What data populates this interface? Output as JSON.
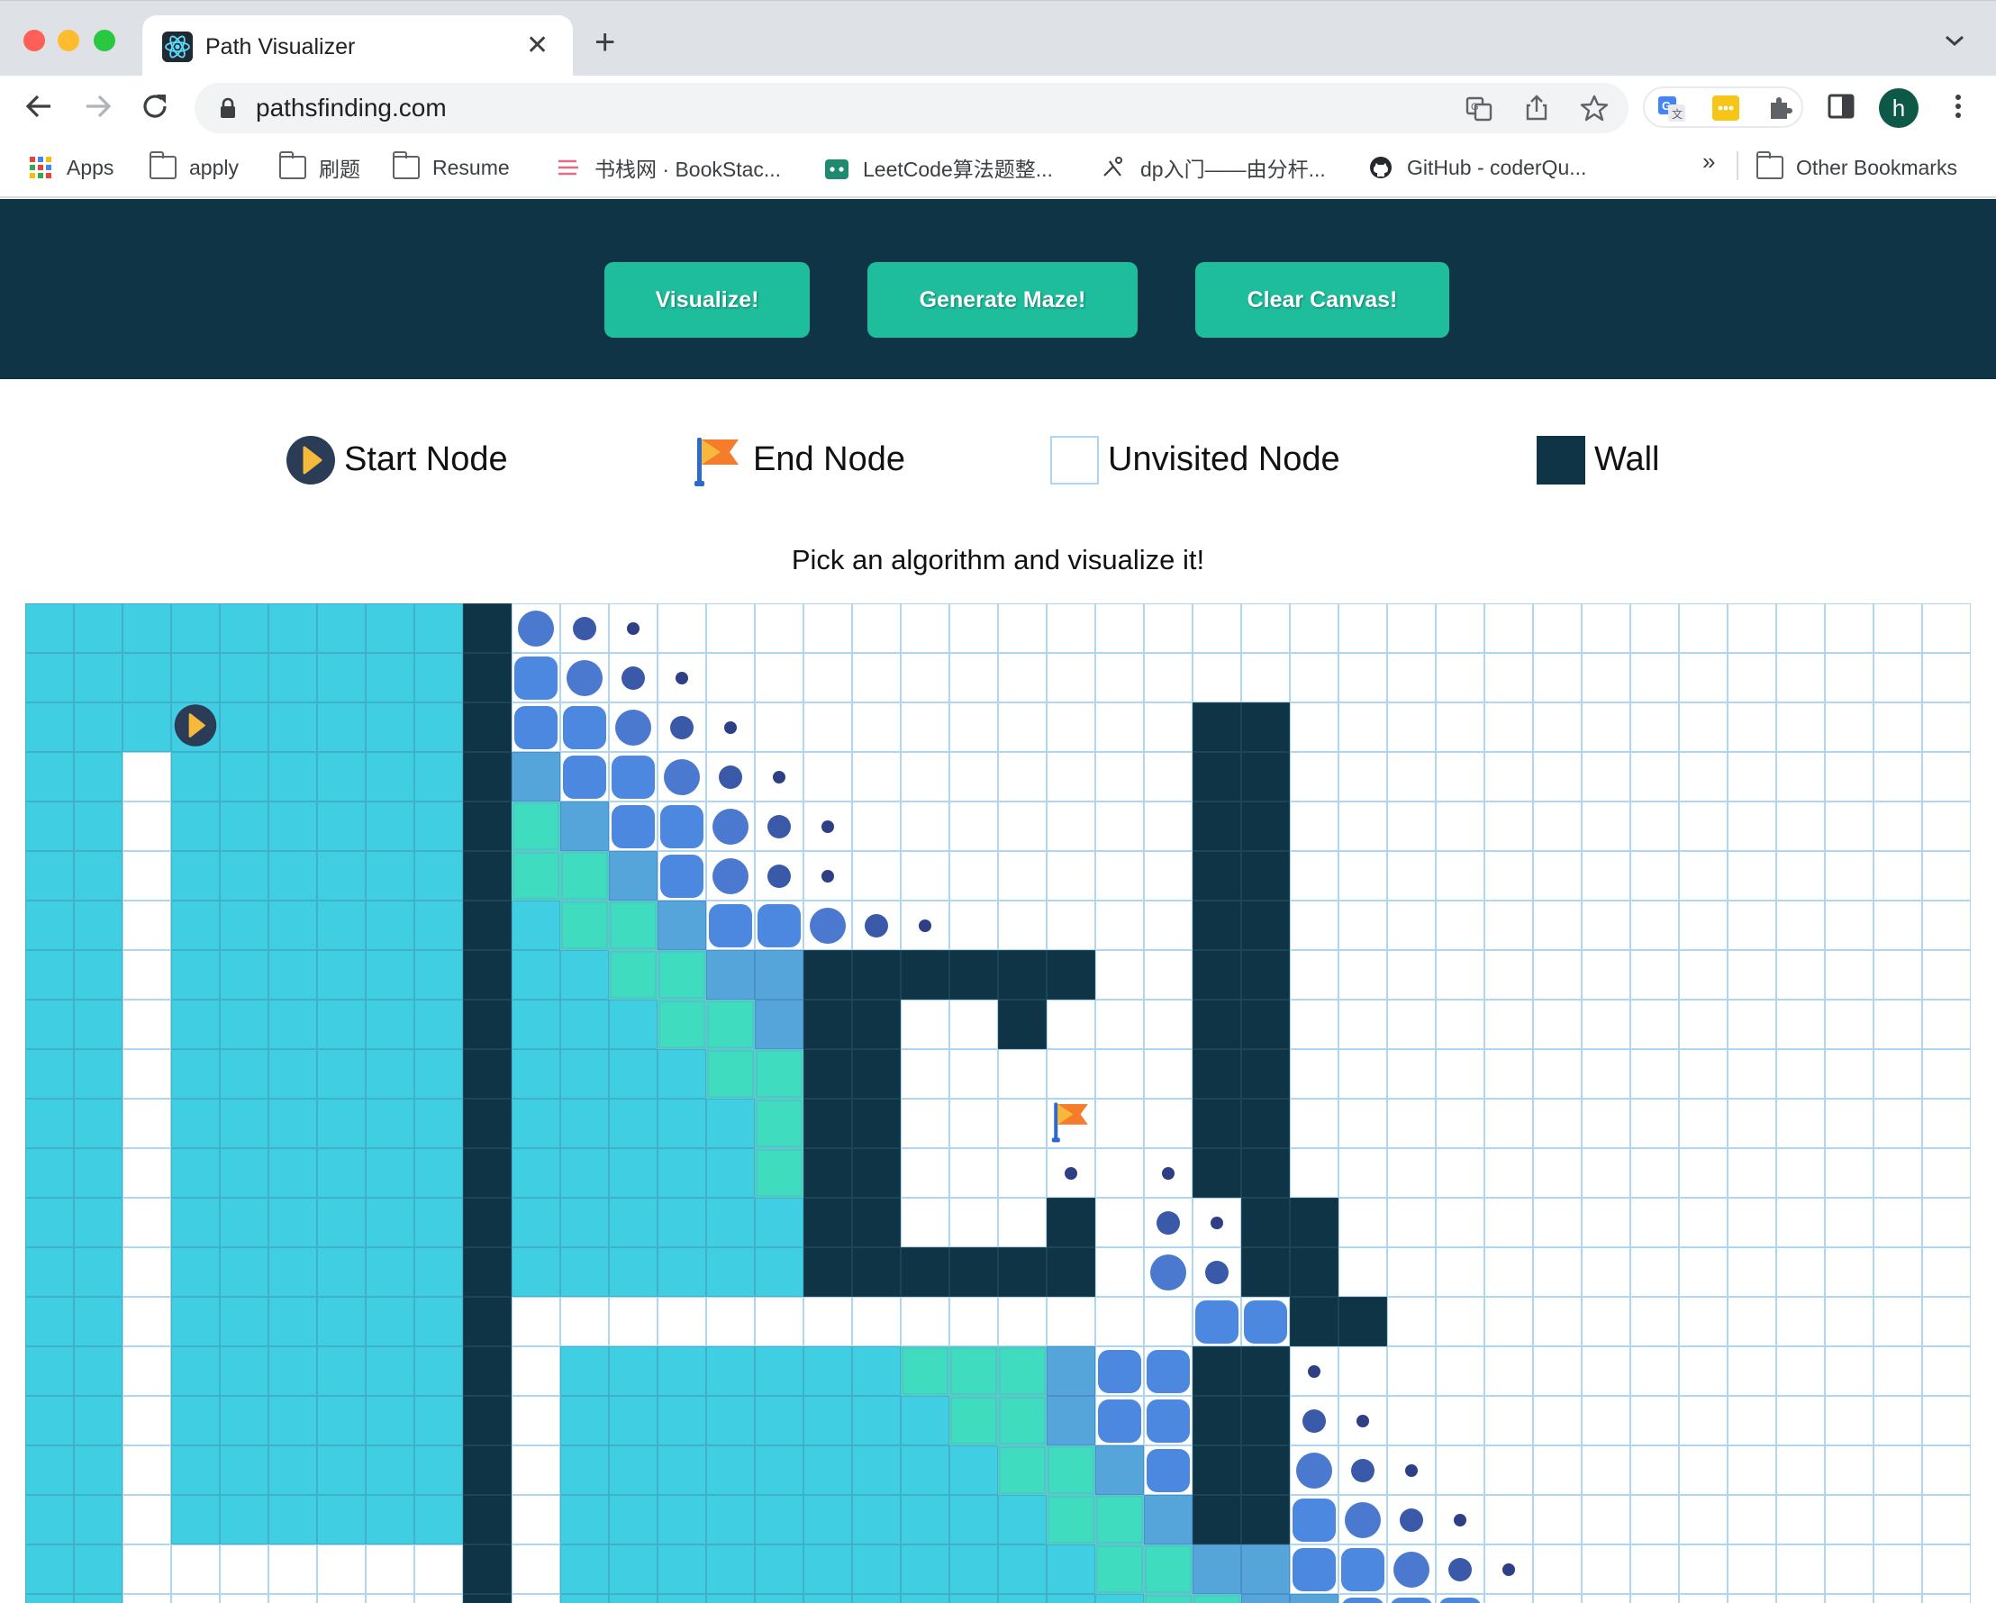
{
  "browser": {
    "tab_title": "Path Visualizer",
    "url": "pathsfinding.com",
    "avatar_letter": "h",
    "bookmarks": [
      {
        "label": "Apps",
        "icon": "apps-grid-icon"
      },
      {
        "label": "apply",
        "icon": "folder-icon"
      },
      {
        "label": "刷题",
        "icon": "folder-icon"
      },
      {
        "label": "Resume",
        "icon": "folder-icon"
      },
      {
        "label": "书栈网 · BookStac...",
        "icon": "bookstack-icon"
      },
      {
        "label": "LeetCode算法题整...",
        "icon": "leetcode-icon"
      },
      {
        "label": "dp入门——由分杆...",
        "icon": "yoga-icon"
      },
      {
        "label": "GitHub - coderQu...",
        "icon": "github-icon"
      }
    ],
    "more_bookmarks": "»",
    "other_bookmarks": "Other Bookmarks"
  },
  "header": {
    "visualize_label": "Visualize!",
    "maze_label": "Generate Maze!",
    "clear_label": "Clear Canvas!"
  },
  "legend": {
    "start": "Start Node",
    "end": "End Node",
    "unvisited": "Unvisited Node",
    "wall": "Wall"
  },
  "subtitle": "Pick an algorithm and visualize it!",
  "colors": {
    "header_bg": "#0e3446",
    "button": "#1ebd9c",
    "visited": "#40cee3",
    "wall": "#0e3446",
    "grid_line": "#aed6f0"
  },
  "grid": {
    "columns": 40,
    "rows": 21,
    "start_node": {
      "row": 2,
      "col": 2
    },
    "end_node": {
      "row": 10,
      "col": 20
    },
    "cell_map": [
      "VVVVVVVVVW321 ..........................",
      "VVVVVVVVVW4321 .........................",
      "VVVSVVVVVW44321.........WW..............",
      "VV.VVVVVVWB44321........WW..............",
      "VV.VVVVVVWTB44321.......WW..............",
      "VV.VVVVVVWTTB4321.......WW..............",
      "VV.VVVVVVWVTTB44321.....WW..............",
      "VV.VVVVVVWVVTTBBWWWWWW..WW..............",
      "VV.VVVVVVWVVVTTBWW..W...WW..............",
      "VV.VVVVVVWVVVVTTWW......WW..............",
      "VV.VVVVVVWVVVVVTWW...E..WW..............",
      "VV.VVVVVVWVVVVVTWW...1.1WW..............",
      "VV.VVVVVVWVVVVVVWW...W.21WW.............",
      "VV.VVVVVVWVVVVVVWWWWWW.32WW.............",
      "VV.VVVVVVW..............44WW............",
      "VV.VVVVVVW.VVVVVVVTTTB44WW1.............",
      "VV.VVVVVVW.VVVVVVVVTTB44WW21............",
      "VV.VVVVVVW.VVVVVVVVVTTB4WW321...........",
      "VV.VVVVVVW.VVVVVVVVVVTTBWW4321..........",
      "VV.......W.VVVVVVVVVVVTTBB44321.........",
      "VV.......W.VVVVVVVVVVVVTTBB4441.........."
    ]
  }
}
